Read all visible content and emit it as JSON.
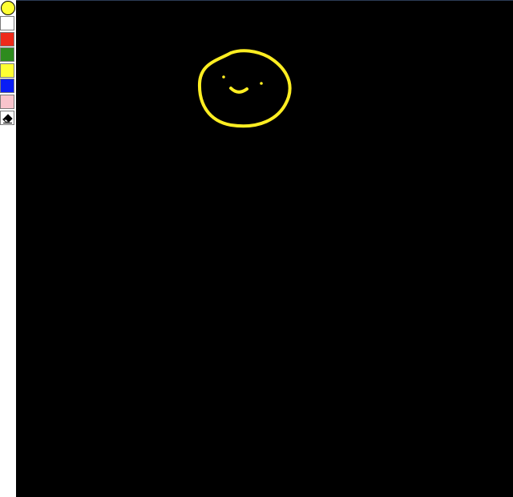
{
  "palette": {
    "current_color": "#ffff33",
    "swatches": [
      {
        "name": "white",
        "color": "#ffffff"
      },
      {
        "name": "red",
        "color": "#ee2a1a"
      },
      {
        "name": "green",
        "color": "#2e8b1e"
      },
      {
        "name": "yellow",
        "color": "#ffff33"
      },
      {
        "name": "blue",
        "color": "#0a1df5"
      },
      {
        "name": "pink",
        "color": "#f8c4cc"
      }
    ],
    "eraser_icon": "eraser-icon"
  },
  "canvas": {
    "background": "#000000",
    "stroke_color": "#ffee22"
  }
}
